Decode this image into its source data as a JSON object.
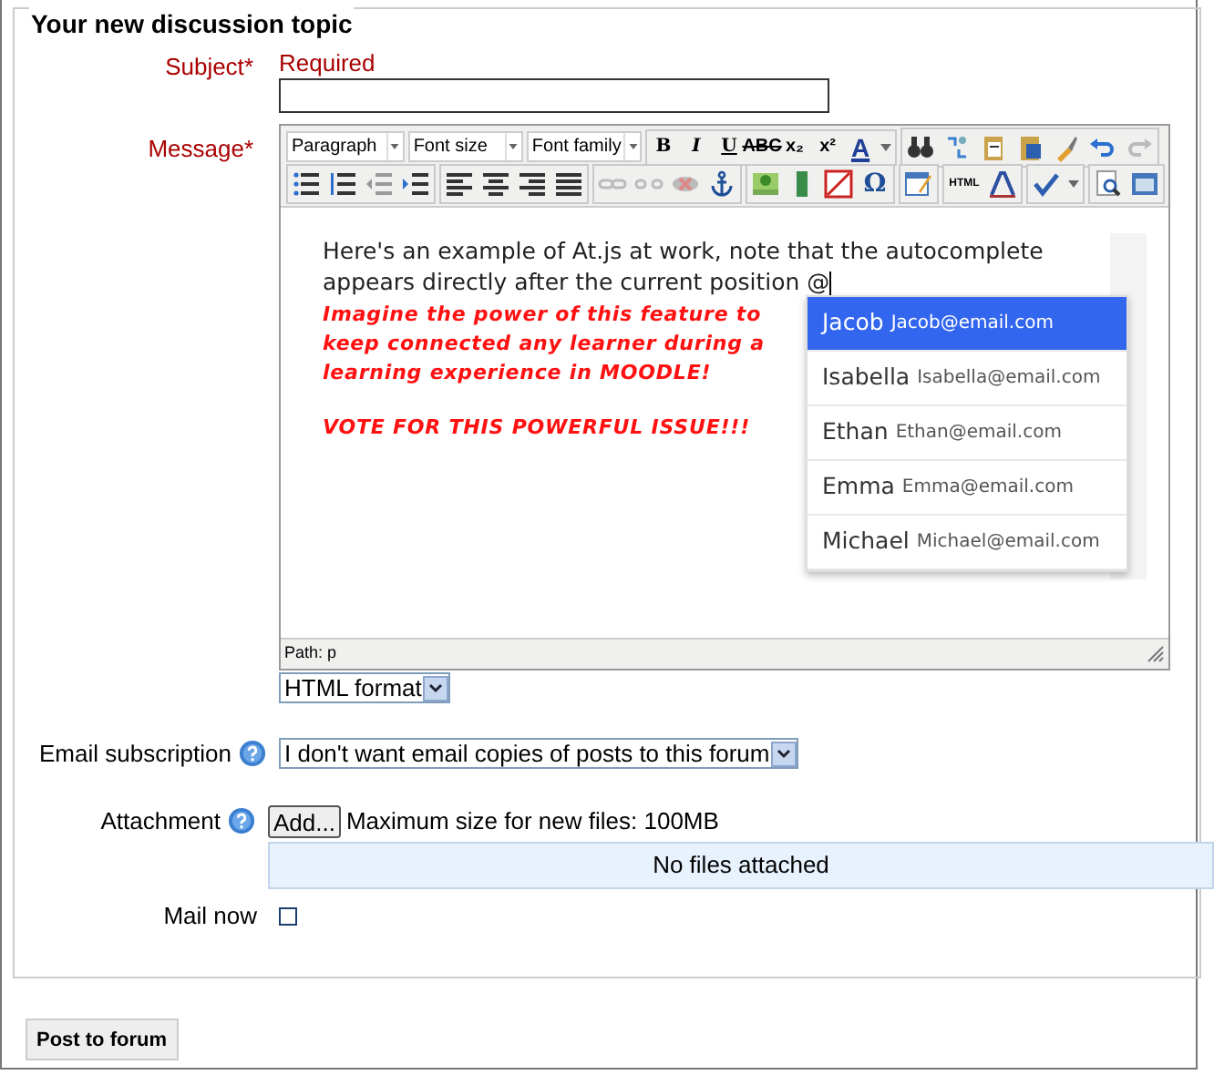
{
  "legend": "Your new discussion topic",
  "subject": {
    "label": "Subject",
    "required_mark": "*",
    "hint": "Required"
  },
  "message": {
    "label": "Message",
    "required_mark": "*",
    "selects": [
      "Paragraph",
      "Font size",
      "Font family"
    ],
    "format_buttons": [
      "B",
      "I",
      "U",
      "ABC",
      "x₂",
      "x²",
      "A"
    ],
    "special_char": "Ω",
    "html_button": "HTML",
    "text": "Here's an example of At.js at work, note that the autocomplete appears directly after the current position @",
    "highlights": [
      "Imagine the power of this feature to keep connected any learner during a learning experience in MOODLE!",
      "VOTE FOR THIS POWERFUL ISSUE!!!"
    ],
    "mentions": [
      {
        "name": "Jacob",
        "email": "Jacob@email.com",
        "selected": true
      },
      {
        "name": "Isabella",
        "email": "Isabella@email.com",
        "selected": false
      },
      {
        "name": "Ethan",
        "email": "Ethan@email.com",
        "selected": false
      },
      {
        "name": "Emma",
        "email": "Emma@email.com",
        "selected": false
      },
      {
        "name": "Michael",
        "email": "Michael@email.com",
        "selected": false
      }
    ],
    "path": "Path: p",
    "format": "HTML format"
  },
  "email_subscription": {
    "label": "Email subscription",
    "value": "I don't want email copies of posts to this forum"
  },
  "attachment": {
    "label": "Attachment",
    "button": "Add...",
    "note": "Maximum size for new files: 100MB",
    "empty": "No files attached"
  },
  "mail_now": {
    "label": "Mail now",
    "checked": false
  },
  "submit": "Post to forum"
}
